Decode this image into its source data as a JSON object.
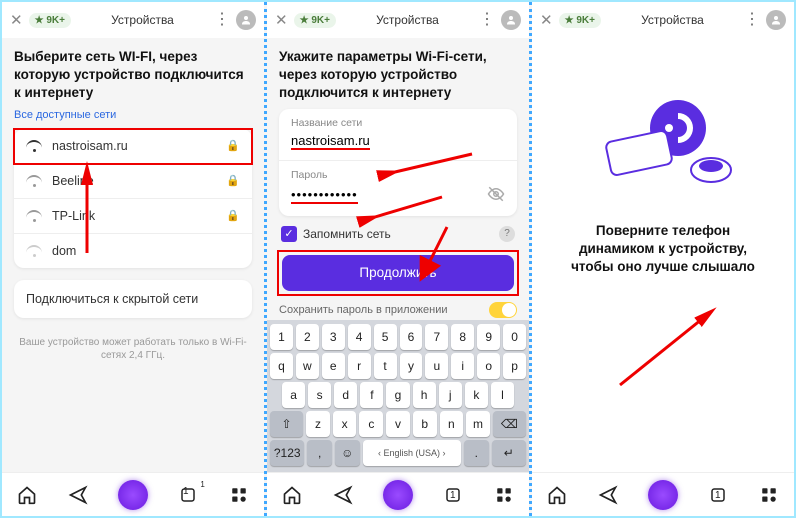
{
  "topbar": {
    "rating_badge": "★ 9K+",
    "tab_title": "Устройства"
  },
  "screen1": {
    "heading": "Выберите сеть WI-FI, через которую устройство подключится к интернету",
    "all_networks_link": "Все доступные сети",
    "networks": [
      {
        "name": "nastroisam.ru",
        "signal": "strong",
        "locked": true,
        "highlight": true
      },
      {
        "name": "Beeline",
        "signal": "med",
        "locked": true
      },
      {
        "name": "TP-Link",
        "signal": "med",
        "locked": true
      },
      {
        "name": "dom",
        "signal": "weak",
        "locked": false
      }
    ],
    "hidden_network": "Подключиться к скрытой сети",
    "footnote": "Ваше устройство может работать только в Wi-Fi-сетях 2,4 ГГц."
  },
  "screen2": {
    "heading": "Укажите параметры Wi-Fi-сети, через которую устройство подключится к интернету",
    "ssid_label": "Название сети",
    "ssid_value": "nastroisam.ru",
    "password_label": "Пароль",
    "password_mask": "••••••••••••",
    "remember_label": "Запомнить сеть",
    "continue_label": "Продолжить",
    "save_password_label": "Сохранить пароль в приложении",
    "keyboard": {
      "row1": [
        "1",
        "2",
        "3",
        "4",
        "5",
        "6",
        "7",
        "8",
        "9",
        "0"
      ],
      "row2": [
        "q",
        "w",
        "e",
        "r",
        "t",
        "y",
        "u",
        "i",
        "o",
        "p"
      ],
      "row3": [
        "a",
        "s",
        "d",
        "f",
        "g",
        "h",
        "j",
        "k",
        "l"
      ],
      "row4_shift": "⇧",
      "row4": [
        "z",
        "x",
        "c",
        "v",
        "b",
        "n",
        "m"
      ],
      "row4_del": "⌫",
      "row5_sym": "?123",
      "row5_comma": ",",
      "row5_emoji": "☺",
      "row5_space": "English (USA)",
      "row5_dot": ".",
      "row5_enter": "↵"
    }
  },
  "screen3": {
    "message": "Поверните телефон динамиком к устройству, чтобы оно лучше слышало"
  },
  "nav": {
    "tabs_badge": "1"
  },
  "colors": {
    "accent": "#5a2de0",
    "highlight": "#e00000"
  }
}
